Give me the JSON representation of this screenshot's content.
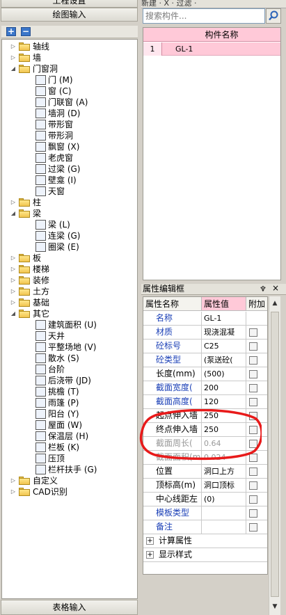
{
  "left_panel": {
    "top_header": "工程设置",
    "section_title": "绘图输入",
    "bottom_tab": "表格输入",
    "toolbar": {
      "add": "+",
      "remove": "−"
    }
  },
  "tree": [
    {
      "label": "轴线",
      "expander": "+",
      "type": "folder"
    },
    {
      "label": "墙",
      "expander": "+",
      "type": "folder"
    },
    {
      "label": "门窗洞",
      "expander": "−",
      "type": "folder-open"
    },
    {
      "label": "门 (M)",
      "type": "leaf",
      "icon": "door-icon"
    },
    {
      "label": "窗 (C)",
      "type": "leaf",
      "icon": "window-icon"
    },
    {
      "label": "门联窗 (A)",
      "type": "leaf",
      "icon": "door-window-icon"
    },
    {
      "label": "墙洞 (D)",
      "type": "leaf",
      "icon": "wall-hole-icon"
    },
    {
      "label": "带形窗",
      "type": "leaf",
      "icon": "strip-window-icon"
    },
    {
      "label": "带形洞",
      "type": "leaf",
      "icon": "strip-hole-icon"
    },
    {
      "label": "飘窗 (X)",
      "type": "leaf",
      "icon": "bay-window-icon"
    },
    {
      "label": "老虎窗",
      "type": "leaf",
      "icon": "dormer-window-icon"
    },
    {
      "label": "过梁 (G)",
      "type": "leaf",
      "icon": "lintel-icon"
    },
    {
      "label": "壁龛 (I)",
      "type": "leaf",
      "icon": "niche-icon"
    },
    {
      "label": "天窗",
      "type": "leaf",
      "icon": "skylight-icon"
    },
    {
      "label": "柱",
      "expander": "+",
      "type": "folder"
    },
    {
      "label": "梁",
      "expander": "−",
      "type": "folder-open"
    },
    {
      "label": "梁 (L)",
      "type": "leaf",
      "icon": "beam-icon"
    },
    {
      "label": "连梁 (G)",
      "type": "leaf",
      "icon": "coupling-beam-icon"
    },
    {
      "label": "圈梁 (E)",
      "type": "leaf",
      "icon": "ring-beam-icon"
    },
    {
      "label": "板",
      "expander": "+",
      "type": "folder"
    },
    {
      "label": "楼梯",
      "expander": "+",
      "type": "folder"
    },
    {
      "label": "装修",
      "expander": "+",
      "type": "folder"
    },
    {
      "label": "土方",
      "expander": "+",
      "type": "folder"
    },
    {
      "label": "基础",
      "expander": "+",
      "type": "folder"
    },
    {
      "label": "其它",
      "expander": "−",
      "type": "folder-open"
    },
    {
      "label": "建筑面积 (U)",
      "type": "leaf",
      "icon": "building-area-icon"
    },
    {
      "label": "天井",
      "type": "leaf",
      "icon": "courtyard-icon"
    },
    {
      "label": "平整场地 (V)",
      "type": "leaf",
      "icon": "site-leveling-icon"
    },
    {
      "label": "散水 (S)",
      "type": "leaf",
      "icon": "apron-icon"
    },
    {
      "label": "台阶",
      "type": "leaf",
      "icon": "steps-icon"
    },
    {
      "label": "后浇带 (JD)",
      "type": "leaf",
      "icon": "post-pour-strip-icon"
    },
    {
      "label": "挑檐 (T)",
      "type": "leaf",
      "icon": "cornice-icon"
    },
    {
      "label": "雨篷 (P)",
      "type": "leaf",
      "icon": "canopy-icon"
    },
    {
      "label": "阳台 (Y)",
      "type": "leaf",
      "icon": "balcony-icon"
    },
    {
      "label": "屋面 (W)",
      "type": "leaf",
      "icon": "roof-icon"
    },
    {
      "label": "保温层 (H)",
      "type": "leaf",
      "icon": "insulation-icon"
    },
    {
      "label": "栏板 (K)",
      "type": "leaf",
      "icon": "parapet-icon"
    },
    {
      "label": "压顶",
      "type": "leaf",
      "icon": "coping-icon"
    },
    {
      "label": "栏杆扶手 (G)",
      "type": "leaf",
      "icon": "railing-icon"
    },
    {
      "label": "自定义",
      "expander": "+",
      "type": "folder"
    },
    {
      "label": "CAD识别",
      "expander": "+",
      "type": "folder"
    }
  ],
  "right_top": {
    "toolbar_text": "新建 · X · 过滤 ·",
    "search_placeholder": "搜索构件..."
  },
  "component_list": {
    "header": "构件名称",
    "rows": [
      {
        "num": "1",
        "name": "GL-1"
      }
    ]
  },
  "property_panel": {
    "title": "属性编辑框",
    "pin": "♆",
    "close": "×",
    "headers": {
      "name": "属性名称",
      "value": "属性值",
      "extra": "附加"
    },
    "rows": [
      {
        "name": "名称",
        "value": "GL-1",
        "style": "blue",
        "check": false
      },
      {
        "name": "材质",
        "value": "现浇混凝",
        "style": "blue",
        "check": true
      },
      {
        "name": "砼标号",
        "value": "C25",
        "style": "blue",
        "check": true
      },
      {
        "name": "砼类型",
        "value": "(泵送砼(",
        "style": "blue",
        "check": true
      },
      {
        "name": "长度(mm)",
        "value": "(500)",
        "style": "normal",
        "check": true
      },
      {
        "name": "截面宽度(",
        "value": "200",
        "style": "blue",
        "check": true
      },
      {
        "name": "截面高度(",
        "value": "120",
        "style": "blue",
        "check": true
      },
      {
        "name": "起点伸入墙",
        "value": "250",
        "style": "normal",
        "check": true
      },
      {
        "name": "终点伸入墙",
        "value": "250",
        "style": "normal",
        "check": true
      },
      {
        "name": "截面周长(",
        "value": "0.64",
        "style": "gray",
        "check": true
      },
      {
        "name": "截面面积(m",
        "value": "0.024",
        "style": "gray",
        "check": true
      },
      {
        "name": "位置",
        "value": "洞口上方",
        "style": "normal",
        "check": true
      },
      {
        "name": "顶标高(m)",
        "value": "洞口顶标",
        "style": "normal",
        "check": true
      },
      {
        "name": "中心线距左",
        "value": "(0)",
        "style": "normal",
        "check": true
      },
      {
        "name": "模板类型",
        "value": "",
        "style": "blue",
        "check": true
      },
      {
        "name": "备注",
        "value": "",
        "style": "blue",
        "check": true
      },
      {
        "name": "计算属性",
        "value": "",
        "style": "group",
        "check": false
      },
      {
        "name": "显示样式",
        "value": "",
        "style": "group",
        "check": false
      }
    ]
  },
  "colors": {
    "selection_pink": "#ffc9d8",
    "annotation_red": "#e81a1a",
    "label_blue": "#1a3fb6"
  }
}
